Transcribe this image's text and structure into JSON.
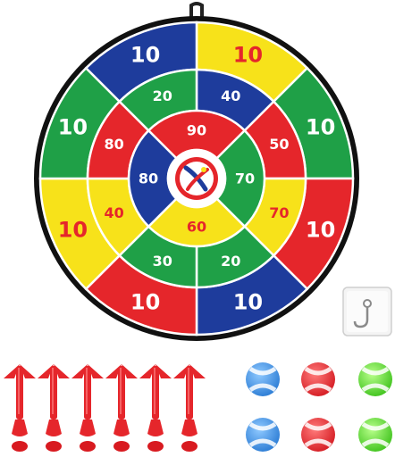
{
  "board": {
    "outer_scores": [
      "10",
      "10",
      "10",
      "10",
      "10",
      "10",
      "10",
      "10"
    ],
    "outer_colors": [
      "#f7e21a",
      "#1fa047",
      "#e5262b",
      "#1e3c9c",
      "#e5262b",
      "#f7e21a",
      "#1fa047",
      "#1e3c9c"
    ],
    "middle_scores": [
      "40",
      "50",
      "70",
      "20",
      "30",
      "40",
      "80",
      "20"
    ],
    "middle_colors": [
      "#1e3c9c",
      "#e5262b",
      "#f7e21a",
      "#1fa047",
      "#1fa047",
      "#f7e21a",
      "#e5262b",
      "#1fa047"
    ],
    "inner_scores": [
      "90",
      "70",
      "60",
      "80"
    ],
    "inner_colors": [
      "#e5262b",
      "#1fa047",
      "#f7e21a",
      "#1e3c9c"
    ],
    "rim_color": "#111111",
    "divider_color": "#ffffff",
    "bullseye_icon": "bullseye-logo-icon"
  },
  "accessories": {
    "darts_count_label": "",
    "dart_color": "#e5262b",
    "ball_colors": [
      "#3a8fe0",
      "#e5262b",
      "#5ad23a"
    ],
    "hook_icon": "wall-hook-icon"
  }
}
